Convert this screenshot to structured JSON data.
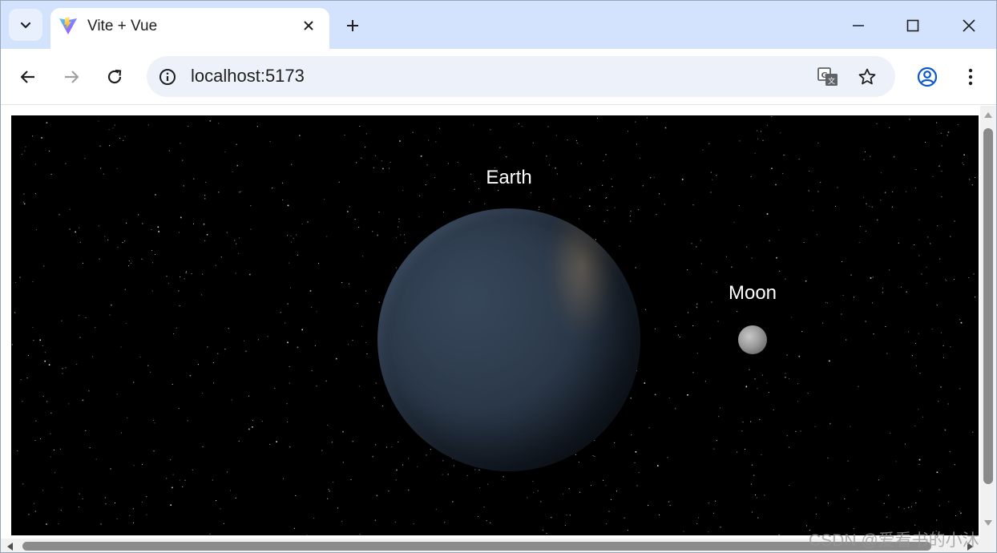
{
  "browser": {
    "tab": {
      "title": "Vite + Vue"
    },
    "address_bar": {
      "url": "localhost:5173"
    }
  },
  "scene": {
    "earth_label": "Earth",
    "moon_label": "Moon"
  },
  "overlay": {
    "watermark": "CSDN @爱看书的小沐"
  },
  "icons": {
    "tab_search": "chevron-down-icon",
    "favicon": "vite-logo-icon",
    "tab_close": "close-icon",
    "new_tab": "plus-icon",
    "minimize": "minimize-icon",
    "maximize": "maximize-icon",
    "close_window": "close-icon",
    "back": "arrow-left-icon",
    "forward": "arrow-right-icon",
    "reload": "reload-icon",
    "site_info": "info-icon",
    "translate": "translate-icon",
    "bookmark": "star-icon",
    "profile": "account-icon",
    "menu": "more-vertical-icon"
  },
  "colors": {
    "tabstrip_bg": "#d3e3fd",
    "omnibox_bg": "#edf2fa",
    "scene_bg": "#000000",
    "earth_base": "#2b394a",
    "moon_base": "#9a9a9a"
  }
}
